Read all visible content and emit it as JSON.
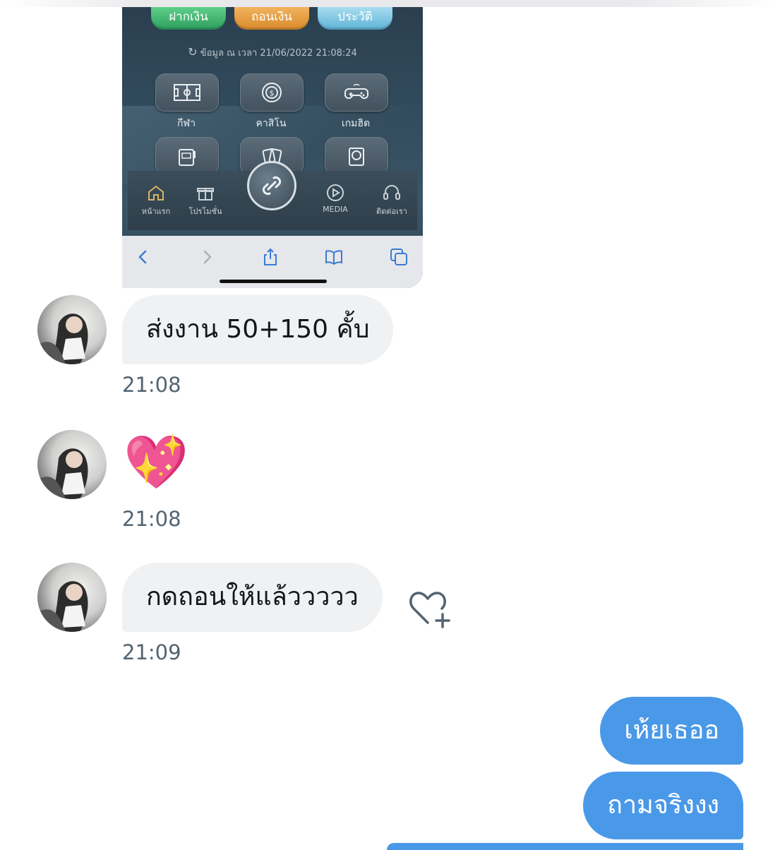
{
  "screenshot": {
    "buttons": [
      "ฝากเงิน",
      "ถอนเงิน",
      "ประวัติ"
    ],
    "data_timestamp": "ข้อมูล ณ เวลา 21/06/2022 21:08:24",
    "games": [
      {
        "label": "กีฬา",
        "icon": "soccer-field-icon"
      },
      {
        "label": "คาสิโน",
        "icon": "casino-chip-icon"
      },
      {
        "label": "เกมฮิต",
        "icon": "gamepad-icon"
      }
    ],
    "nav": [
      {
        "label": "หน้าแรก",
        "icon": "home-icon"
      },
      {
        "label": "โปรโมชั่น",
        "icon": "gift-icon"
      },
      {
        "label": "MEDIA",
        "icon": "play-icon"
      },
      {
        "label": "ติดต่อเรา",
        "icon": "headset-icon"
      }
    ]
  },
  "messages": [
    {
      "text": "ส่งงาน 50+150 คั้บ",
      "time": "21:08"
    },
    {
      "text": "💖",
      "time": "21:08"
    },
    {
      "text": "กดถอนให้แล้ววววว",
      "time": "21:09"
    }
  ],
  "sent": [
    "เห้ยเธออ",
    "ถามจริงงง"
  ],
  "colors": {
    "sent_bubble": "#4a99e9",
    "received_bubble": "#eff1f3",
    "time_text": "#536471"
  }
}
